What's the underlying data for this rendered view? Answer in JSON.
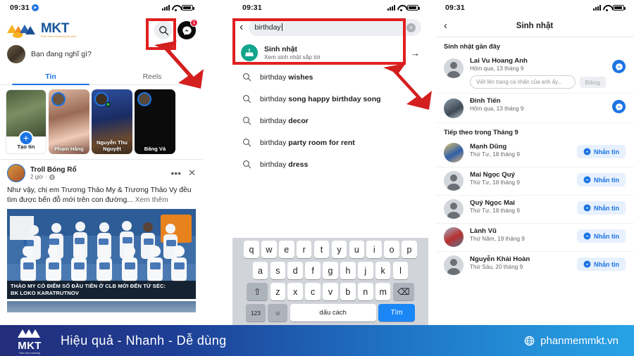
{
  "status_bar": {
    "time": "09:31"
  },
  "panel1": {
    "brand": {
      "name": "MKT",
      "tagline": "Phần mềm marketing đa kênh"
    },
    "header_icons": {
      "search": "search-icon",
      "messenger": "messenger-icon",
      "messenger_badge": "1"
    },
    "composer": {
      "placeholder": "Bạn đang nghĩ gì?"
    },
    "tabs": [
      {
        "label": "Tin",
        "active": true
      },
      {
        "label": "Reels",
        "active": false
      }
    ],
    "stories": [
      {
        "label": "Tạo tin",
        "type": "create"
      },
      {
        "label": "Phạm Hằng",
        "type": "story"
      },
      {
        "label": "Nguyễn Thu Nguyệt",
        "type": "story"
      },
      {
        "label": "Băng Và",
        "type": "story"
      }
    ],
    "post": {
      "author": "Troll Bóng Rổ",
      "time": "2 giờ",
      "privacy": "globe-icon",
      "text": "Như vậy, chị em Trương Thảo My & Trương Thảo Vy đều tìm được bến đỗ mới trên con đường...",
      "more": "Xem thêm",
      "image_caption_line1": "THẢO MY CÓ ĐIỂM SỐ ĐẦU TIÊN Ở CLB MỚI ĐẾN TỪ SÉC:",
      "image_caption_line2": "BK LOKO KARATRUTNOV"
    }
  },
  "panel2": {
    "search": {
      "value": "birthday",
      "clear": "×"
    },
    "suggestion_top": {
      "title": "Sinh nhật",
      "subtitle": "Xem sinh nhật sắp tới",
      "icon": "cake-icon"
    },
    "suggestions": [
      {
        "plain": "birthday ",
        "bold": "wishes"
      },
      {
        "plain": "birthday ",
        "bold": "song happy birthday song"
      },
      {
        "plain": "birthday ",
        "bold": "decor"
      },
      {
        "plain": "birthday ",
        "bold": "party room for rent"
      },
      {
        "plain": "birthday ",
        "bold": "dress"
      }
    ],
    "keyboard": {
      "row1": [
        "q",
        "w",
        "e",
        "r",
        "t",
        "y",
        "u",
        "i",
        "o",
        "p"
      ],
      "row2": [
        "a",
        "s",
        "d",
        "f",
        "g",
        "h",
        "j",
        "k",
        "l"
      ],
      "row3": [
        "z",
        "x",
        "c",
        "v",
        "b",
        "n",
        "m"
      ],
      "shift": "⇧",
      "backspace": "⌫",
      "numbers": "123",
      "emoji": "☺",
      "space": "dấu cách",
      "go": "Tìm"
    }
  },
  "panel3": {
    "title": "Sinh nhật",
    "back": "‹",
    "sections": [
      {
        "heading": "Sinh nhật gần đây",
        "rows": [
          {
            "name": "Lai Vu Hoang Anh",
            "date": "Hôm qua, 13 tháng 9",
            "action": "messenger-circle",
            "wish_placeholder": "Viết lên trang cá nhân của anh ấy...",
            "wish_button": "Đăng"
          },
          {
            "name": "Đinh Tiến",
            "date": "Hôm qua, 13 tháng 9",
            "action": "messenger-circle"
          }
        ]
      },
      {
        "heading": "Tiếp theo trong Tháng 9",
        "rows": [
          {
            "name": "Mạnh Dũng",
            "date": "Thứ Tư, 18 tháng 9",
            "action": "Nhắn tin"
          },
          {
            "name": "Mai Ngọc Quý",
            "date": "Thứ Tư, 18 tháng 9",
            "action": "Nhắn tin"
          },
          {
            "name": "Quý Ngọc Mai",
            "date": "Thứ Tư, 18 tháng 9",
            "action": "Nhắn tin"
          },
          {
            "name": "Lành Vũ",
            "date": "Thứ Năm, 19 tháng 9",
            "action": "Nhắn tin"
          },
          {
            "name": "Nguyễn Khải Hoàn",
            "date": "Thứ Sáu, 20 tháng 9",
            "action": "Nhắn tin"
          }
        ]
      }
    ]
  },
  "banner": {
    "logo_text": "MKT",
    "logo_sub": "Phần mềm marketing",
    "slogan": "Hiệu quả - Nhanh  - Dễ dùng",
    "url": "phanmemmkt.vn",
    "globe_icon": "globe-icon"
  },
  "colors": {
    "fb_blue": "#1b74e4",
    "highlight_red": "#e02020",
    "teal": "#12a58c",
    "banner_start": "#232d7a",
    "banner_end": "#28a3e6"
  }
}
